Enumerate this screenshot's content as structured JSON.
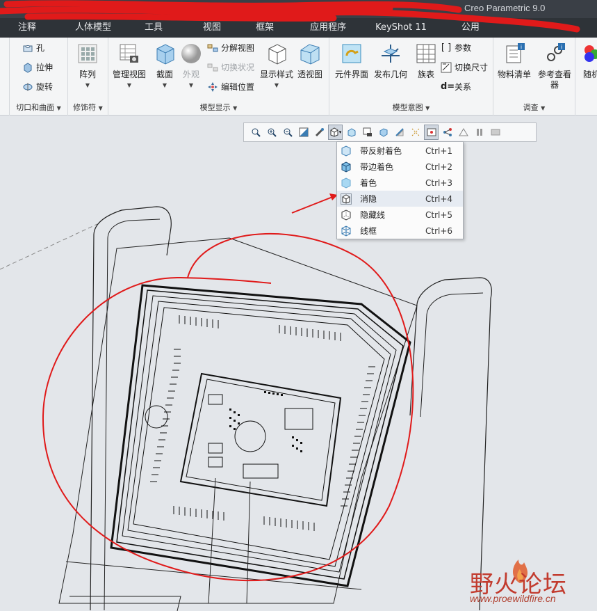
{
  "app_title": "Creo Parametric 9.0",
  "menu_tabs": [
    "注释",
    "人体模型",
    "工具",
    "视图",
    "框架",
    "应用程序",
    "KeyShot 11",
    "公用"
  ],
  "ribbon": {
    "cut_group": {
      "label": "切口和曲面",
      "items": [
        "孔",
        "拉伸",
        "旋转"
      ]
    },
    "modifier_group": {
      "label": "修饰符",
      "pattern": "阵列"
    },
    "display_group": {
      "label": "模型显示",
      "manage_views": "管理视图",
      "section": "截面",
      "appearance": "外观",
      "explode_view": "分解视图",
      "toggle_state": "切换状况",
      "edit_position": "编辑位置",
      "display_style": "显示样式",
      "perspective": "透视图"
    },
    "intent_group": {
      "label": "模型意图",
      "component_interface": "元件界面",
      "publish_geometry": "发布几何",
      "family_table": "族表",
      "parameters": "参数",
      "switch_dimensions": "切换尺寸",
      "relations": "关系"
    },
    "investigate_group": {
      "label": "调查",
      "bom": "物料清单",
      "reference_viewer": "参考查看器"
    },
    "extra": {
      "random": "随机"
    }
  },
  "graphics_toolbar": {
    "icons": [
      "refit-icon",
      "zoom-in-icon",
      "zoom-out-icon",
      "repaint-icon",
      "orient-icon",
      "display-style-icon",
      "saved-orientations-icon",
      "view-manager-icon",
      "perspective-icon",
      "datum-display-icon",
      "annotation-display-icon",
      "spin-center-icon",
      "filter-icon",
      "pause-icon",
      "animation-icon"
    ]
  },
  "display_style_menu": {
    "items": [
      {
        "label": "带反射着色",
        "shortcut": "Ctrl+1"
      },
      {
        "label": "带边着色",
        "shortcut": "Ctrl+2"
      },
      {
        "label": "着色",
        "shortcut": "Ctrl+3"
      },
      {
        "label": "消隐",
        "shortcut": "Ctrl+4"
      },
      {
        "label": "隐藏线",
        "shortcut": "Ctrl+5"
      },
      {
        "label": "线框",
        "shortcut": "Ctrl+6"
      }
    ],
    "highlighted_index": 3
  },
  "watermark": {
    "name": "野火论坛",
    "url": "www.proewildfire.cn"
  },
  "colors": {
    "menubar": "#2e3338",
    "ribbon": "#f4f5f6",
    "canvas": "#e3e6ea",
    "annotation_red": "#e01a1a",
    "watermark_red": "#c23b2e"
  }
}
